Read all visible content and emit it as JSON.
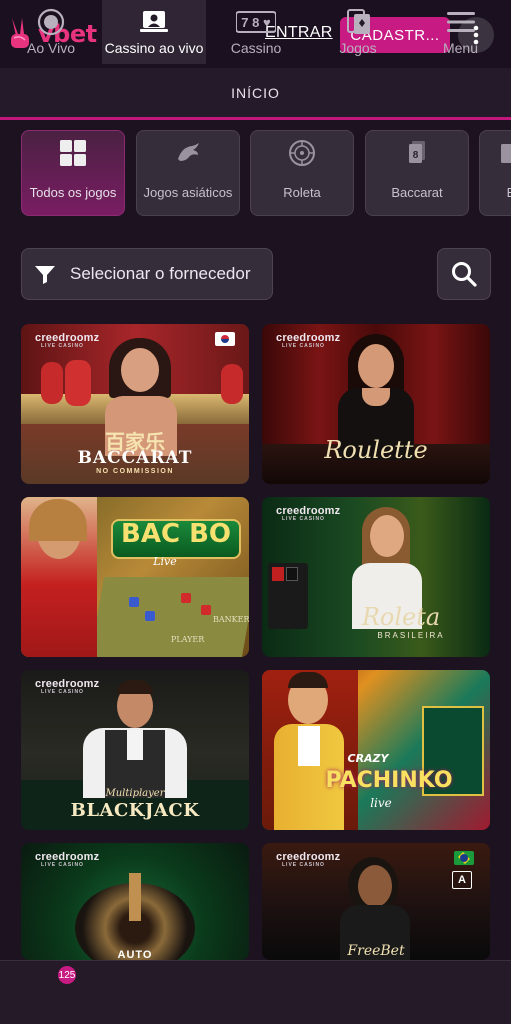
{
  "header": {
    "logo_text": "vbet",
    "login_label": "ENTRAR",
    "signup_label": "CADASTR...",
    "more_icon": "more-vertical-icon",
    "brand_color": "#e8347e"
  },
  "nav_bar": {
    "label": "INÍCIO"
  },
  "categories": [
    {
      "label": "Todos os jogos",
      "icon": "grid-icon",
      "active": true
    },
    {
      "label": "Jogos asiáticos",
      "icon": "dragon-icon",
      "active": false
    },
    {
      "label": "Roleta",
      "icon": "roulette-icon",
      "active": false
    },
    {
      "label": "Baccarat",
      "icon": "cards-icon",
      "active": false
    },
    {
      "label": "B",
      "icon": "cards-icon",
      "active": false
    }
  ],
  "filter": {
    "provider_label": "Selecionar o fornecedor",
    "filter_icon": "funnel-icon",
    "search_icon": "search-icon"
  },
  "games": [
    {
      "brand": "creedroomz",
      "brand_sub": "LIVE CASINO",
      "title": "BACCARAT",
      "subtitle": "NO COMMISSION",
      "chinese": "百家乐"
    },
    {
      "brand": "creedroomz",
      "brand_sub": "LIVE CASINO",
      "title": "Roulette"
    },
    {
      "title": "BAC BO",
      "subtitle": "Live",
      "table_left": "PLAYER",
      "table_right": "BANKER"
    },
    {
      "brand": "creedroomz",
      "brand_sub": "LIVE CASINO",
      "title": "Roleta",
      "subtitle": "BRASILEIRA"
    },
    {
      "brand": "creedroomz",
      "brand_sub": "LIVE CASINO",
      "title": "BLACKJACK",
      "subtitle": "Multiplayer"
    },
    {
      "title": "PACHINKO",
      "subtitle": "CRAZY",
      "suffix": "live"
    },
    {
      "brand": "creedroomz",
      "brand_sub": "LIVE CASINO",
      "title": "AUTO"
    },
    {
      "brand": "creedroomz",
      "brand_sub": "LIVE CASINO",
      "title": "FreeBet"
    }
  ],
  "bottom_nav": [
    {
      "label": "Ao Vivo",
      "icon": "live-icon",
      "badge": "125"
    },
    {
      "label": "Cassino ao vivo",
      "icon": "live-dealer-icon",
      "active": true
    },
    {
      "label": "Cassino",
      "icon": "slot-machine-icon"
    },
    {
      "label": "Jogos",
      "icon": "games-cards-icon"
    },
    {
      "label": "Menu",
      "icon": "hamburger-icon"
    }
  ]
}
